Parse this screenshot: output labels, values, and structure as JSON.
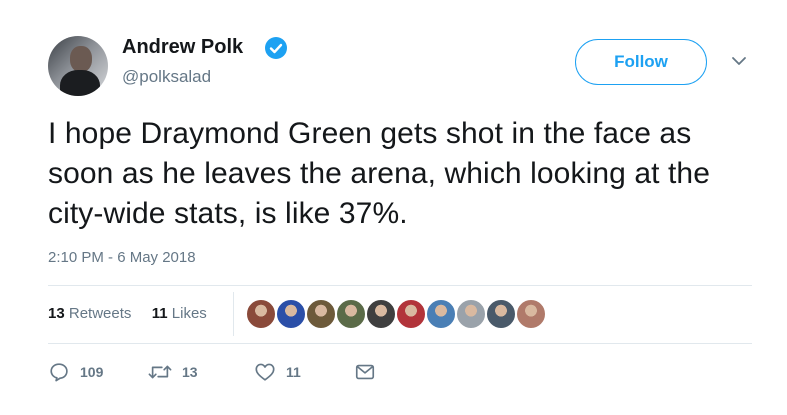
{
  "author": {
    "name": "Andrew Polk",
    "handle": "@polksalad",
    "verified": true,
    "avatar_icon": "user-avatar"
  },
  "follow_label": "Follow",
  "tweet_text": "I hope Draymond Green gets shot in the face as soon as he leaves the arena, which looking at the city-wide stats, is like 37%.",
  "timestamp": "2:10 PM - 6 May 2018",
  "stats": {
    "retweets_count": "13",
    "retweets_label": "Retweets",
    "likes_count": "11",
    "likes_label": "Likes"
  },
  "liker_avatars": [
    {
      "color": "#8a4a3a"
    },
    {
      "color": "#2b4fa8"
    },
    {
      "color": "#6d5a3a"
    },
    {
      "color": "#5b6b48"
    },
    {
      "color": "#3f3f3f"
    },
    {
      "color": "#b2343a"
    },
    {
      "color": "#4a7fb5"
    },
    {
      "color": "#9aa2aa"
    },
    {
      "color": "#4a5a6a"
    },
    {
      "color": "#b07a6a"
    }
  ],
  "actions": {
    "reply": {
      "icon": "reply-icon",
      "count": "109"
    },
    "retweet": {
      "icon": "retweet-icon",
      "count": "13"
    },
    "like": {
      "icon": "heart-icon",
      "count": "11"
    },
    "message": {
      "icon": "envelope-icon"
    }
  },
  "colors": {
    "accent": "#1da1f2",
    "muted": "#657786",
    "text": "#14171a",
    "divider": "#e1e8ed"
  }
}
